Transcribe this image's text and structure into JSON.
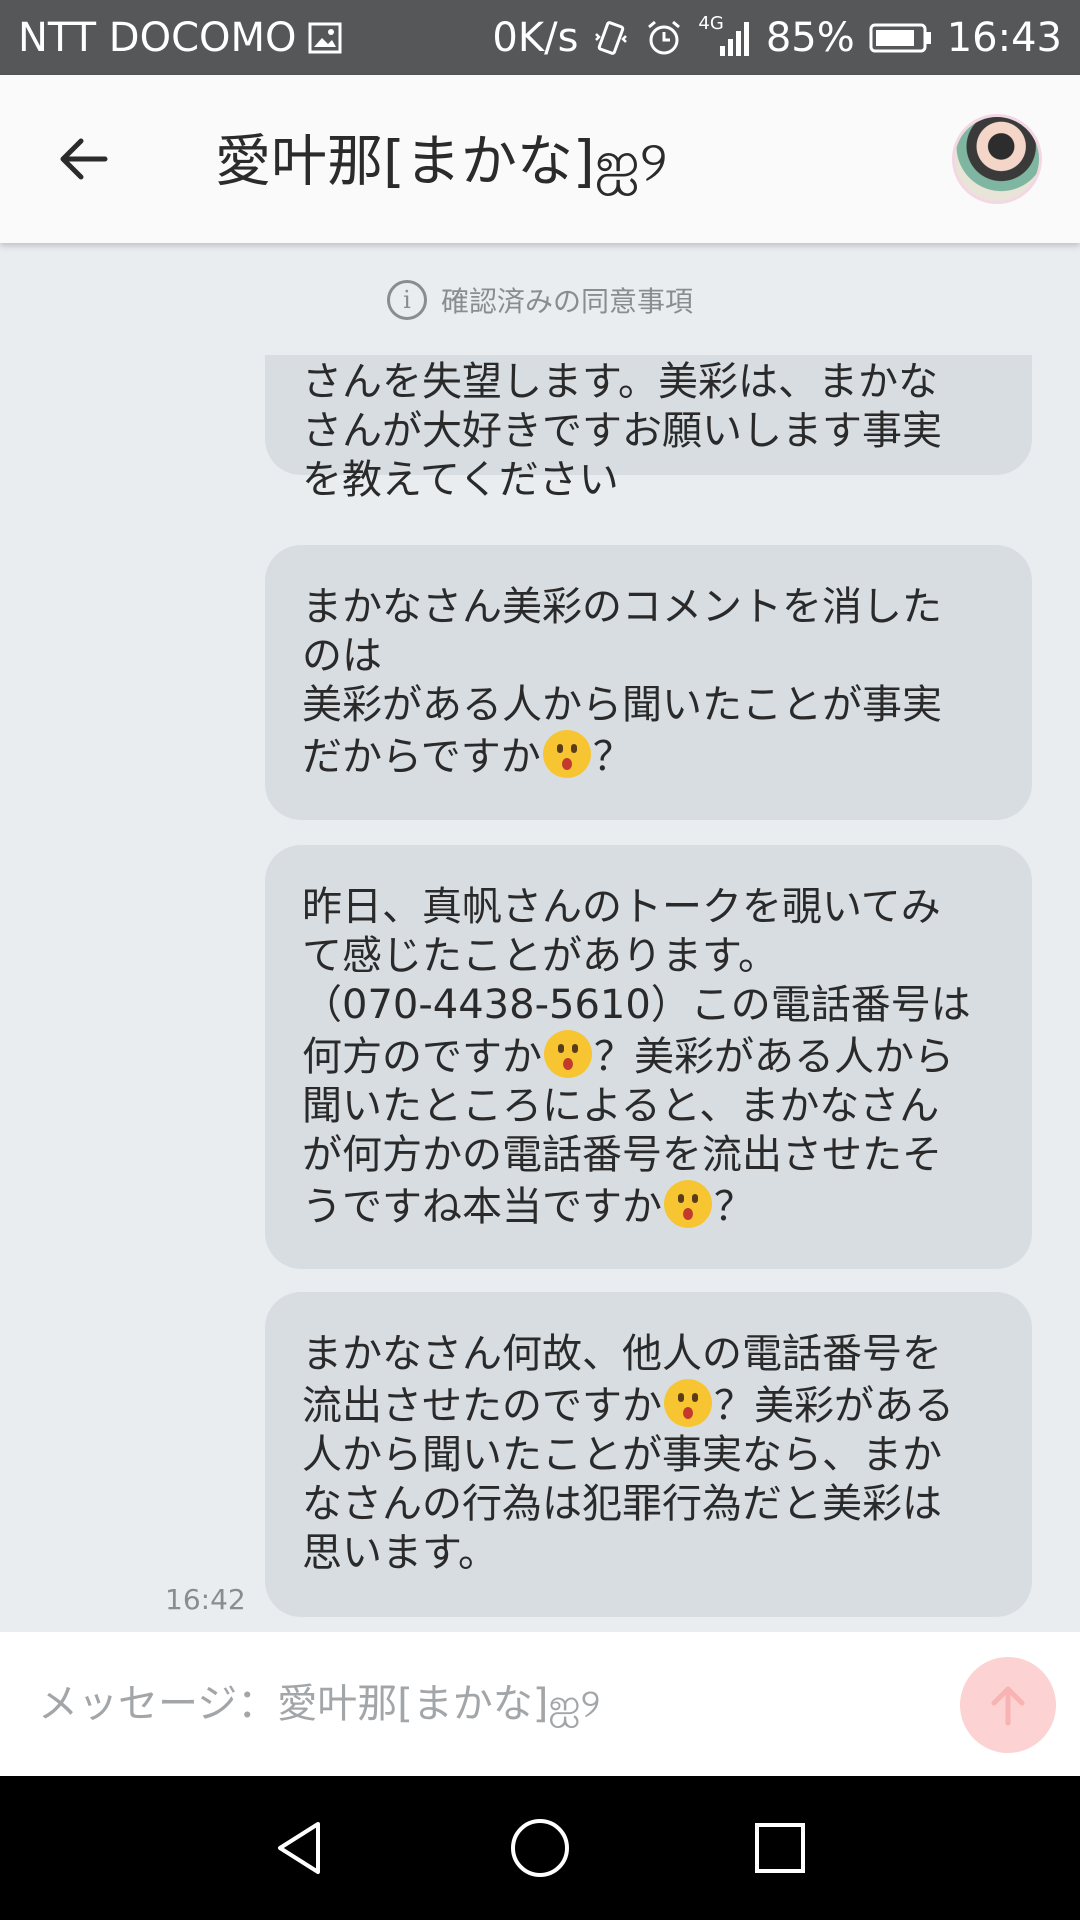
{
  "status_bar": {
    "carrier": "NTT DOCOMO",
    "net_speed": "0K/s",
    "network_type": "4G",
    "battery": "85%",
    "time": "16:43",
    "icons": [
      "image-icon",
      "vibrate-icon",
      "alarm-icon",
      "signal-icon",
      "battery-icon"
    ]
  },
  "header": {
    "title": "愛叶那[まかな]ஐ୨",
    "back_icon": "arrow-left-icon"
  },
  "consent_notice": {
    "icon_glyph": "i",
    "text": "確認済みの同意事項"
  },
  "messages": [
    {
      "parts": [
        "さんを失望します。美彩は、まかな\nさんが大好きですお願いします事実\nを教えてください"
      ]
    },
    {
      "parts": [
        "まかなさん美彩のコメントを消した\nのは\n美彩がある人から聞いたことが事実\nだからですか",
        "{emoji}",
        "？"
      ]
    },
    {
      "parts": [
        "昨日、真帆さんのトークを覗いてみ\nて感じたことがあります。\n（070-4438-5610）この電話番号は\n何方のですか",
        "{emoji}",
        "？美彩がある人から\n聞いたところによると、まかなさん\nが何方かの電話番号を流出させたそ\nうですね本当ですか",
        "{emoji}",
        "？"
      ]
    },
    {
      "parts": [
        "まかなさん何故、他人の電話番号を\n流出させたのですか",
        "{emoji}",
        "？美彩がある\n人から聞いたことが事実なら、まか\nなさんの行為は犯罪行為だと美彩は\n思います。"
      ]
    }
  ],
  "last_message_time": "16:42",
  "composer": {
    "placeholder": "メッセージ：愛叶那[まかな]ஐ୨",
    "value": "",
    "send_icon": "arrow-up-icon"
  },
  "colors": {
    "status_bar_bg": "#555759",
    "app_bar_bg": "#fafafa",
    "chat_bg": "#e9edf0",
    "bubble_bg": "#d8dde2",
    "send_button_bg": "#fcd2d2",
    "nav_bar_bg": "#000000"
  },
  "nav_bar": {
    "icons": [
      "back-triangle-icon",
      "home-circle-icon",
      "recents-square-icon"
    ]
  }
}
